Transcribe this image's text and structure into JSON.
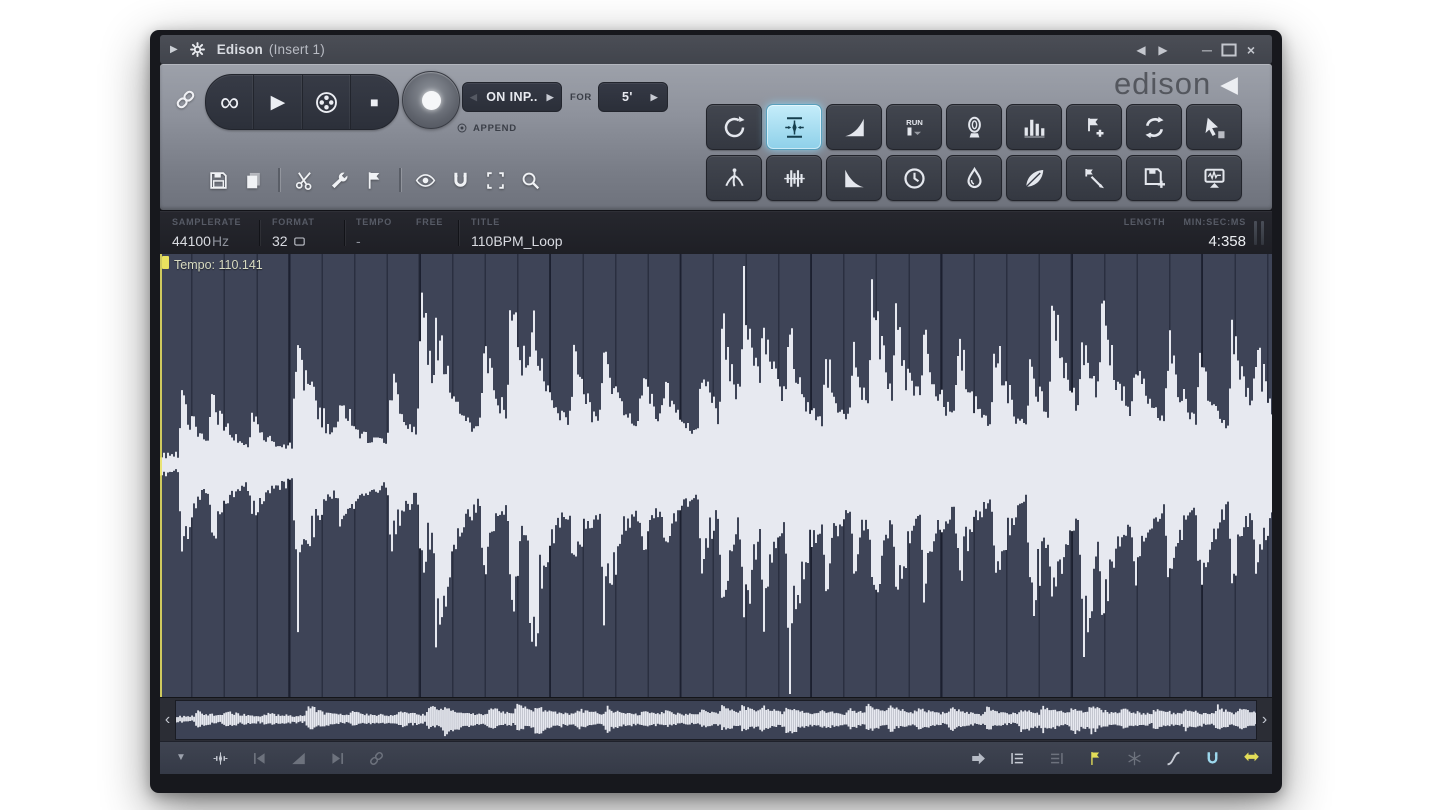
{
  "window": {
    "title": "Edison",
    "title_suffix": "(Insert 1)"
  },
  "logo": {
    "text": "edison"
  },
  "transport": {
    "mode_button": {
      "label": "ON INP.."
    },
    "for_label": "FOR",
    "duration_button": {
      "value": "5'"
    },
    "append_label": "APPEND"
  },
  "info_bar": {
    "fields": [
      {
        "label": "SAMPLERATE",
        "value": "44100",
        "unit": "Hz"
      },
      {
        "label": "FORMAT",
        "value": "32"
      },
      {
        "label": "TEMPO",
        "value": "-"
      },
      {
        "label": "FREE",
        "value": ""
      },
      {
        "label": "TITLE",
        "value": "110BPM_Loop"
      }
    ],
    "length_label": "LENGTH",
    "length_unit_label": "MIN:SEC:MS",
    "length_value": "4:358"
  },
  "wave": {
    "tempo_marker_label": "Tempo: 110.141",
    "colors": {
      "background": "#3e4457",
      "grid": "#2c3246",
      "wave": "#e7e9f0",
      "marker": "#e9e25f"
    },
    "transients": [
      [
        0.02,
        0.4,
        0.45
      ],
      [
        0.047,
        0.28,
        0.3
      ],
      [
        0.083,
        0.18,
        0.18
      ],
      [
        0.123,
        0.85,
        0.75
      ],
      [
        0.163,
        0.25,
        0.22
      ],
      [
        0.208,
        0.45,
        0.4
      ],
      [
        0.235,
        0.92,
        0.5
      ],
      [
        0.249,
        0.4,
        0.88
      ],
      [
        0.291,
        0.6,
        0.45
      ],
      [
        0.316,
        0.95,
        0.6
      ],
      [
        0.334,
        0.45,
        0.85
      ],
      [
        0.372,
        0.5,
        0.45
      ],
      [
        0.399,
        0.55,
        0.8
      ],
      [
        0.433,
        0.38,
        0.3
      ],
      [
        0.453,
        0.28,
        0.24
      ],
      [
        0.487,
        0.5,
        0.45
      ],
      [
        0.506,
        0.65,
        0.55
      ],
      [
        0.525,
        0.75,
        0.6
      ],
      [
        0.543,
        0.55,
        0.5
      ],
      [
        0.566,
        0.5,
        0.92
      ],
      [
        0.599,
        0.45,
        0.38
      ],
      [
        0.624,
        0.42,
        0.36
      ],
      [
        0.641,
        0.88,
        0.6
      ],
      [
        0.662,
        0.6,
        0.5
      ],
      [
        0.687,
        0.52,
        0.46
      ],
      [
        0.718,
        0.55,
        0.48
      ],
      [
        0.751,
        0.6,
        0.52
      ],
      [
        0.783,
        0.45,
        0.75
      ],
      [
        0.803,
        0.82,
        0.55
      ],
      [
        0.83,
        0.55,
        0.88
      ],
      [
        0.847,
        0.75,
        0.48
      ],
      [
        0.877,
        0.45,
        0.42
      ],
      [
        0.907,
        0.55,
        0.48
      ],
      [
        0.935,
        0.42,
        0.55
      ],
      [
        0.964,
        0.7,
        0.5
      ],
      [
        0.986,
        0.45,
        0.4
      ]
    ]
  },
  "toolbars": {
    "edit_row": [
      "save",
      "copy",
      "sep",
      "scissors",
      "wrench",
      "flag",
      "sep",
      "eye",
      "magnet",
      "select",
      "zoom"
    ],
    "tool_grid": [
      [
        {
          "name": "reverse"
        },
        {
          "name": "normalize",
          "active": true
        },
        {
          "name": "fade-in"
        },
        {
          "name": "run-script"
        },
        {
          "name": "denoise"
        },
        {
          "name": "equalize"
        },
        {
          "name": "insert-marker"
        },
        {
          "name": "loop"
        },
        {
          "name": "select-tool"
        }
      ],
      [
        {
          "name": "claw"
        },
        {
          "name": "declick"
        },
        {
          "name": "fade-out"
        },
        {
          "name": "time-stretch"
        },
        {
          "name": "blur"
        },
        {
          "name": "sine"
        },
        {
          "name": "slice-marker"
        },
        {
          "name": "save-as"
        },
        {
          "name": "send-to-playlist"
        }
      ]
    ],
    "bottom_left": [
      {
        "name": "caret-down",
        "cls": "small"
      },
      {
        "name": "wave-edit",
        "cls": "bright"
      },
      {
        "name": "prev-marker"
      },
      {
        "name": "fade-wedge"
      },
      {
        "name": "next-marker"
      },
      {
        "name": "chain"
      }
    ],
    "bottom_right": [
      {
        "name": "play-to",
        "cls": "lt"
      },
      {
        "name": "list-left",
        "cls": "bright"
      },
      {
        "name": "list-right"
      },
      {
        "name": "flag-marker",
        "cls": "yellow"
      },
      {
        "name": "snowflake"
      },
      {
        "name": "smooth",
        "cls": "bright"
      },
      {
        "name": "magnet-snap",
        "cls": "cyan"
      },
      {
        "name": "swap-selection",
        "cls": "yellow"
      }
    ]
  }
}
